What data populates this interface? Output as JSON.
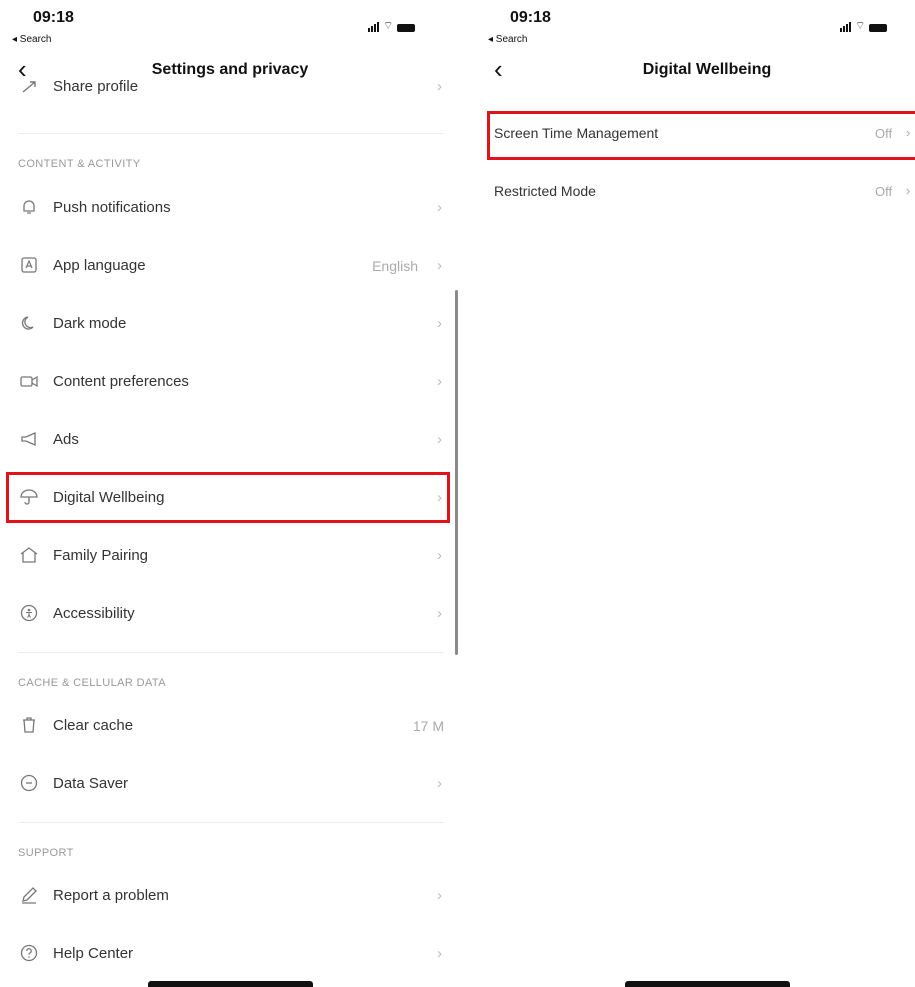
{
  "status_bar": {
    "time": "09:18",
    "back_app": "◂ Search"
  },
  "left_screen": {
    "back_icon": "chevron-left-icon",
    "title": "Settings and privacy",
    "partial_item": {
      "label": "Share profile",
      "icon": "share-icon"
    },
    "sections": [
      {
        "title": "CONTENT & ACTIVITY",
        "items": [
          {
            "label": "Push notifications",
            "icon": "bell-icon",
            "value": ""
          },
          {
            "label": "App language",
            "icon": "language-icon",
            "value": "English"
          },
          {
            "label": "Dark mode",
            "icon": "moon-icon",
            "value": ""
          },
          {
            "label": "Content preferences",
            "icon": "video-icon",
            "value": ""
          },
          {
            "label": "Ads",
            "icon": "megaphone-icon",
            "value": ""
          },
          {
            "label": "Digital Wellbeing",
            "icon": "umbrella-icon",
            "value": "",
            "highlighted": true
          },
          {
            "label": "Family Pairing",
            "icon": "house-icon",
            "value": ""
          },
          {
            "label": "Accessibility",
            "icon": "accessibility-icon",
            "value": ""
          }
        ]
      },
      {
        "title": "CACHE & CELLULAR DATA",
        "items": [
          {
            "label": "Clear cache",
            "icon": "trash-icon",
            "value": "17 M"
          },
          {
            "label": "Data Saver",
            "icon": "data-saver-icon",
            "value": ""
          }
        ]
      },
      {
        "title": "SUPPORT",
        "items": [
          {
            "label": "Report a problem",
            "icon": "pencil-icon",
            "value": ""
          },
          {
            "label": "Help Center",
            "icon": "question-icon",
            "value": ""
          }
        ]
      }
    ]
  },
  "right_screen": {
    "back_icon": "chevron-left-icon",
    "title": "Digital Wellbeing",
    "items": [
      {
        "label": "Screen Time Management",
        "value": "Off",
        "highlighted": true
      },
      {
        "label": "Restricted Mode",
        "value": "Off"
      }
    ]
  },
  "colors": {
    "highlight": "#e0121b",
    "text": "#333333",
    "muted": "#aaaaaa"
  }
}
